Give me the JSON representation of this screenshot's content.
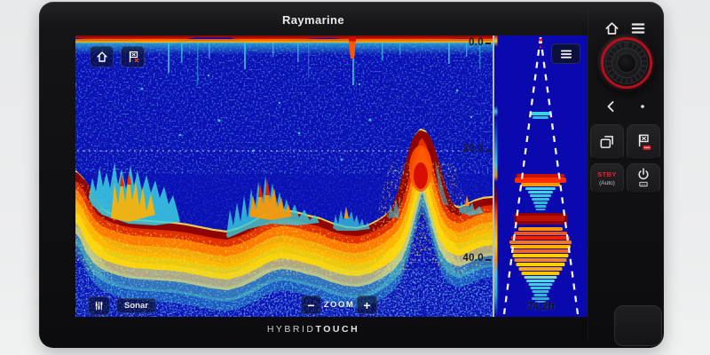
{
  "device": {
    "brand": "Raymarine",
    "hybrid": "HYBRID",
    "touch": "TOUCH"
  },
  "screen": {
    "sonar": {
      "app_label": "Sonar",
      "zoom_label": "ZOOM",
      "zoom_out": "−",
      "zoom_in": "+",
      "depth_labels": [
        "0.0",
        "20.0",
        "40.0"
      ]
    },
    "ascope": {
      "depth_readout": "74.2ft"
    }
  },
  "side_controls": {
    "stby": "STBY",
    "stby_sub": "(Auto)"
  },
  "icons": {
    "screen_home": "home-icon",
    "screen_waypoint": "waypoint-flag-icon",
    "adjust": "sliders-icon",
    "ascope_menu": "menu-icon",
    "panel_home": "home-icon",
    "panel_menu": "menu-icon",
    "panel_back": "back-chevron-icon",
    "panel_select": "dot-icon",
    "panel_switch_pane": "switch-pane-icon",
    "panel_waypoint": "waypoint-mob-icon",
    "panel_power": "power-icon"
  },
  "colors": {
    "background": "#e9eaeb",
    "device_body": "#121214",
    "sonar_blue": "#0a10b4",
    "surface_red": "#d81800",
    "seabed_dark_red": "#8f0400",
    "divider": "#c4ced4",
    "knob_accent_red": "#b3101e",
    "stby_red": "#e8232d"
  }
}
